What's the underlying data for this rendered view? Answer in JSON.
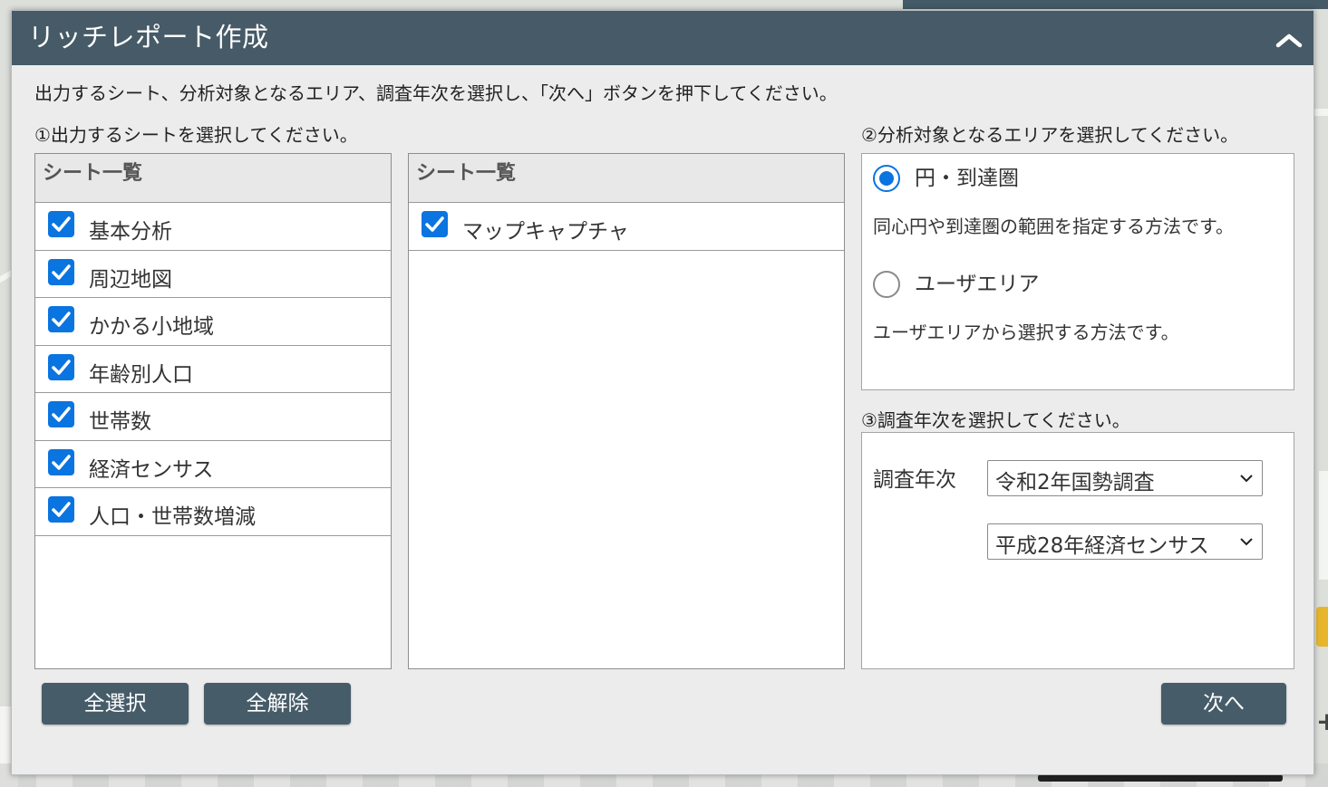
{
  "dialog": {
    "title": "リッチレポート作成",
    "instruction": "出力するシート、分析対象となるエリア、調査年次を選択し、「次へ」ボタンを押下してください。"
  },
  "sheets": {
    "section_label": "①出力するシートを選択してください。",
    "left_panel": {
      "header": "シート一覧",
      "items": [
        {
          "label": "基本分析",
          "checked": true
        },
        {
          "label": "周辺地図",
          "checked": true
        },
        {
          "label": "かかる小地域",
          "checked": true
        },
        {
          "label": "年齢別人口",
          "checked": true
        },
        {
          "label": "世帯数",
          "checked": true
        },
        {
          "label": "経済センサス",
          "checked": true
        },
        {
          "label": "人口・世帯数増減",
          "checked": true
        }
      ]
    },
    "right_panel": {
      "header": "シート一覧",
      "items": [
        {
          "label": "マップキャプチャ",
          "checked": true
        }
      ]
    }
  },
  "area": {
    "section_label": "②分析対象となるエリアを選択してください。",
    "options": [
      {
        "label": "円・到達圏",
        "description": "同心円や到達圏の範囲を指定する方法です。",
        "selected": true
      },
      {
        "label": "ユーザエリア",
        "description": "ユーザエリアから選択する方法です。",
        "selected": false
      }
    ]
  },
  "year": {
    "section_label": "③調査年次を選択してください。",
    "label": "調査年次",
    "census_select": "令和2年国勢調査",
    "economic_select": "平成28年経済センサス"
  },
  "buttons": {
    "select_all": "全選択",
    "deselect_all": "全解除",
    "next": "次へ"
  },
  "colors": {
    "header_bg": "#465a67",
    "accent": "#0a74e0",
    "button_bg": "#475c69"
  }
}
